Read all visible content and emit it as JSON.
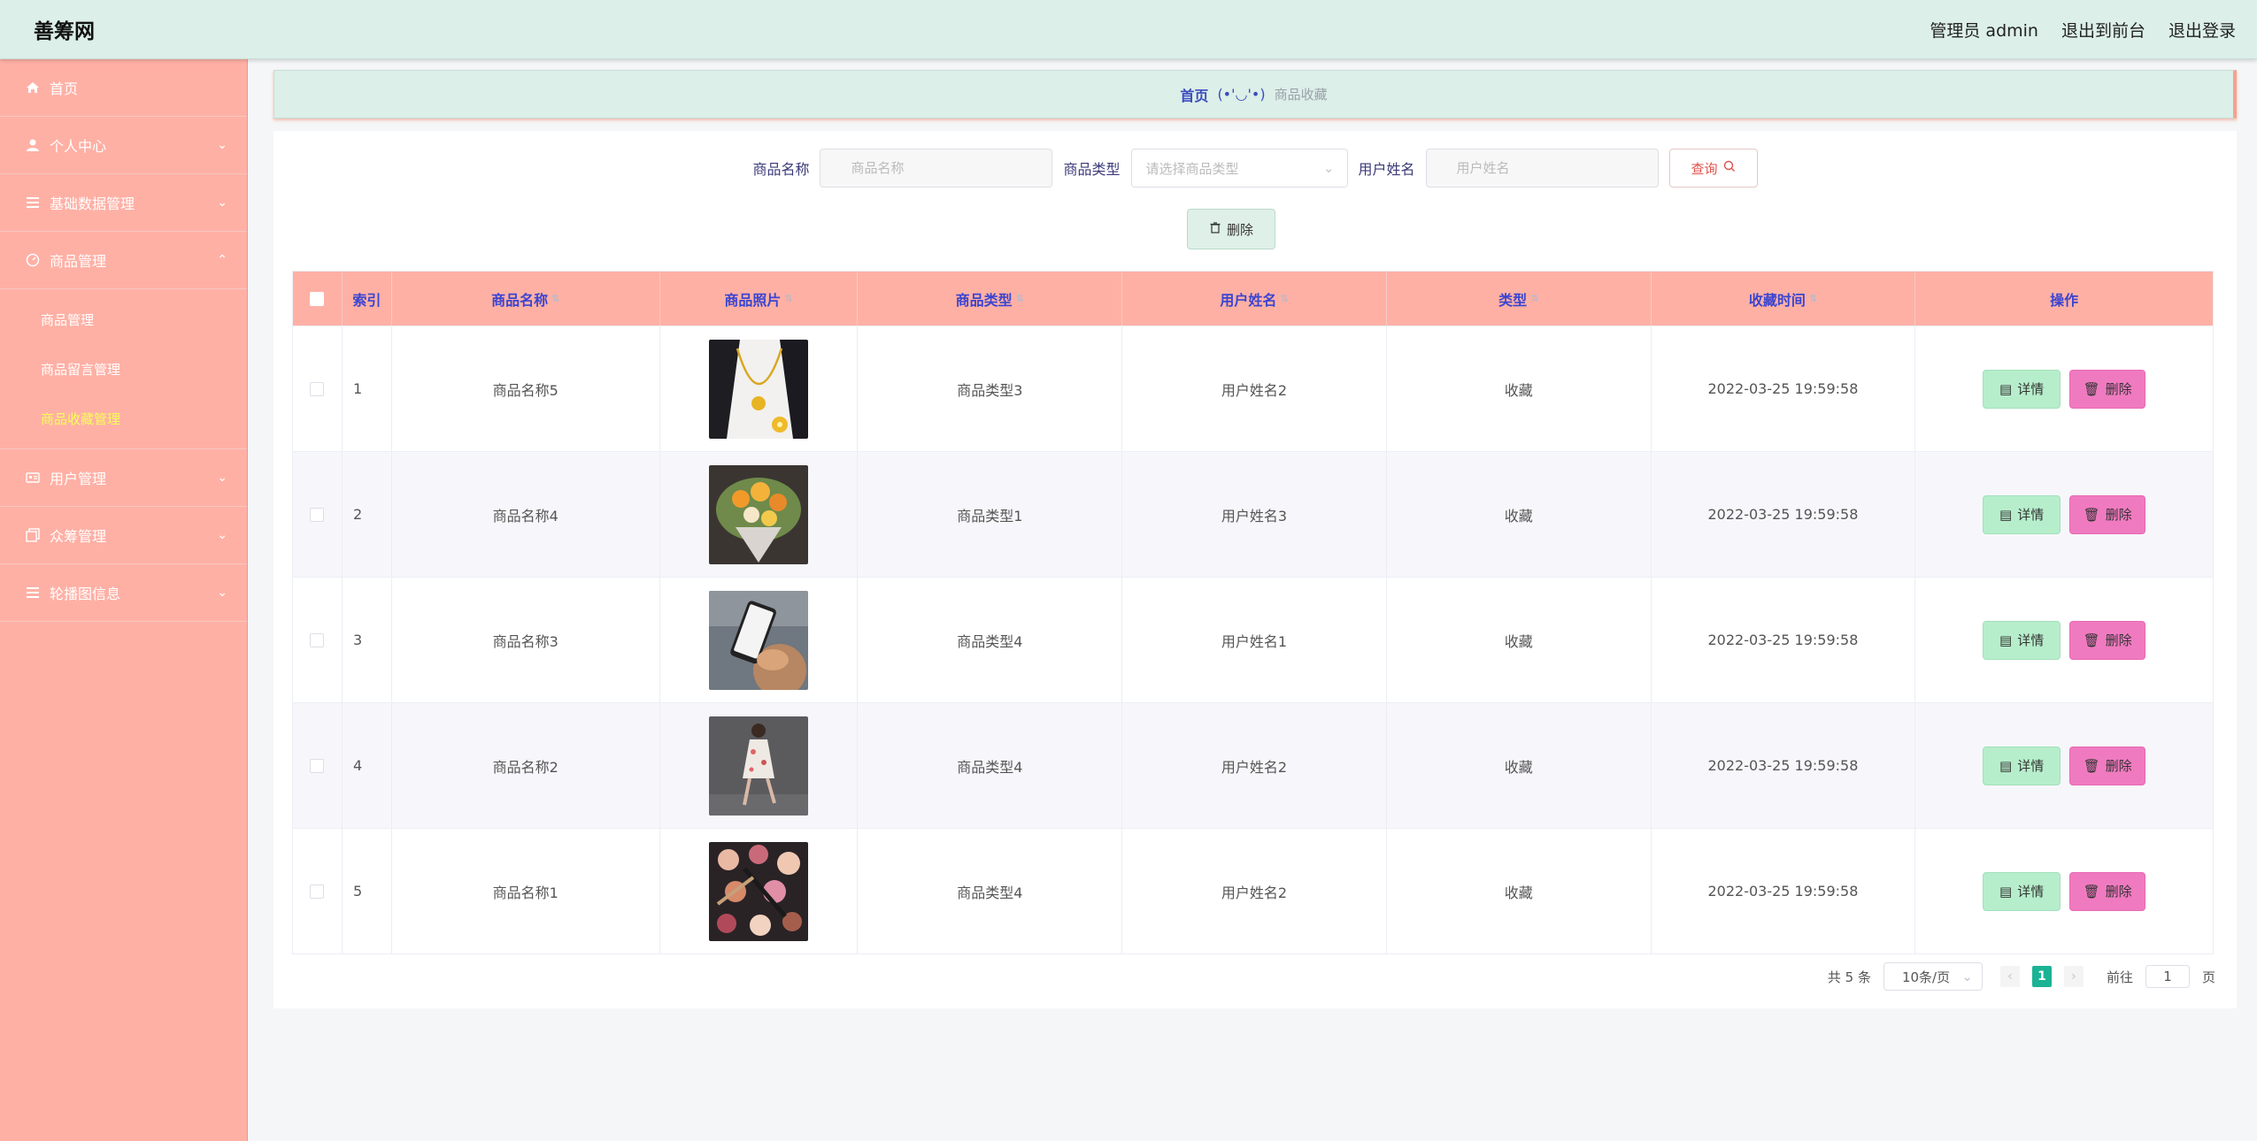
{
  "header": {
    "brand": "善筹网",
    "admin_label": "管理员 admin",
    "back_to_front": "退出到前台",
    "logout": "退出登录"
  },
  "sidebar": {
    "items": [
      {
        "label": "首页",
        "icon": "home-icon"
      },
      {
        "label": "个人中心",
        "icon": "user-icon"
      },
      {
        "label": "基础数据管理",
        "icon": "list-icon"
      },
      {
        "label": "商品管理",
        "icon": "gauge-icon",
        "sub": [
          "商品管理",
          "商品留言管理",
          "商品收藏管理"
        ],
        "active_sub": "商品收藏管理"
      },
      {
        "label": "用户管理",
        "icon": "id-card-icon"
      },
      {
        "label": "众筹管理",
        "icon": "copy-icon"
      },
      {
        "label": "轮播图信息",
        "icon": "list-icon"
      }
    ]
  },
  "breadcrumb": {
    "home": "首页",
    "face": "(•'◡'•)",
    "current": "商品收藏"
  },
  "search": {
    "name_label": "商品名称",
    "name_placeholder": "商品名称",
    "type_label": "商品类型",
    "type_placeholder": "请选择商品类型",
    "user_label": "用户姓名",
    "user_placeholder": "用户姓名",
    "query_label": "查询"
  },
  "toolbar": {
    "delete_label": "删除"
  },
  "table": {
    "columns": [
      "索引",
      "商品名称",
      "商品照片",
      "商品类型",
      "用户姓名",
      "类型",
      "收藏时间",
      "操作"
    ],
    "rows": [
      {
        "index": "1",
        "name": "商品名称5",
        "photo": "necklace",
        "type": "商品类型3",
        "user": "用户姓名2",
        "kind": "收藏",
        "time": "2022-03-25 19:59:58"
      },
      {
        "index": "2",
        "name": "商品名称4",
        "photo": "bouquet",
        "type": "商品类型1",
        "user": "用户姓名3",
        "kind": "收藏",
        "time": "2022-03-25 19:59:58"
      },
      {
        "index": "3",
        "name": "商品名称3",
        "photo": "phone",
        "type": "商品类型4",
        "user": "用户姓名1",
        "kind": "收藏",
        "time": "2022-03-25 19:59:58"
      },
      {
        "index": "4",
        "name": "商品名称2",
        "photo": "dress",
        "type": "商品类型4",
        "user": "用户姓名2",
        "kind": "收藏",
        "time": "2022-03-25 19:59:58"
      },
      {
        "index": "5",
        "name": "商品名称1",
        "photo": "cosmetics",
        "type": "商品类型4",
        "user": "用户姓名2",
        "kind": "收藏",
        "time": "2022-03-25 19:59:58"
      }
    ],
    "detail_label": "详情",
    "delete_label": "删除"
  },
  "pagination": {
    "total": "共 5 条",
    "page_size": "10条/页",
    "current_page": "1",
    "goto_label": "前往",
    "goto_value": "1",
    "page_unit": "页"
  },
  "colors": {
    "sidebar": "#ffb0a5",
    "header": "#dcefe8",
    "table_header": "#ffb0a5",
    "detail_button": "#b6eecb",
    "delete_button": "#f07ac0",
    "active_page": "#1bb394",
    "active_submenu": "#f5ff54"
  }
}
